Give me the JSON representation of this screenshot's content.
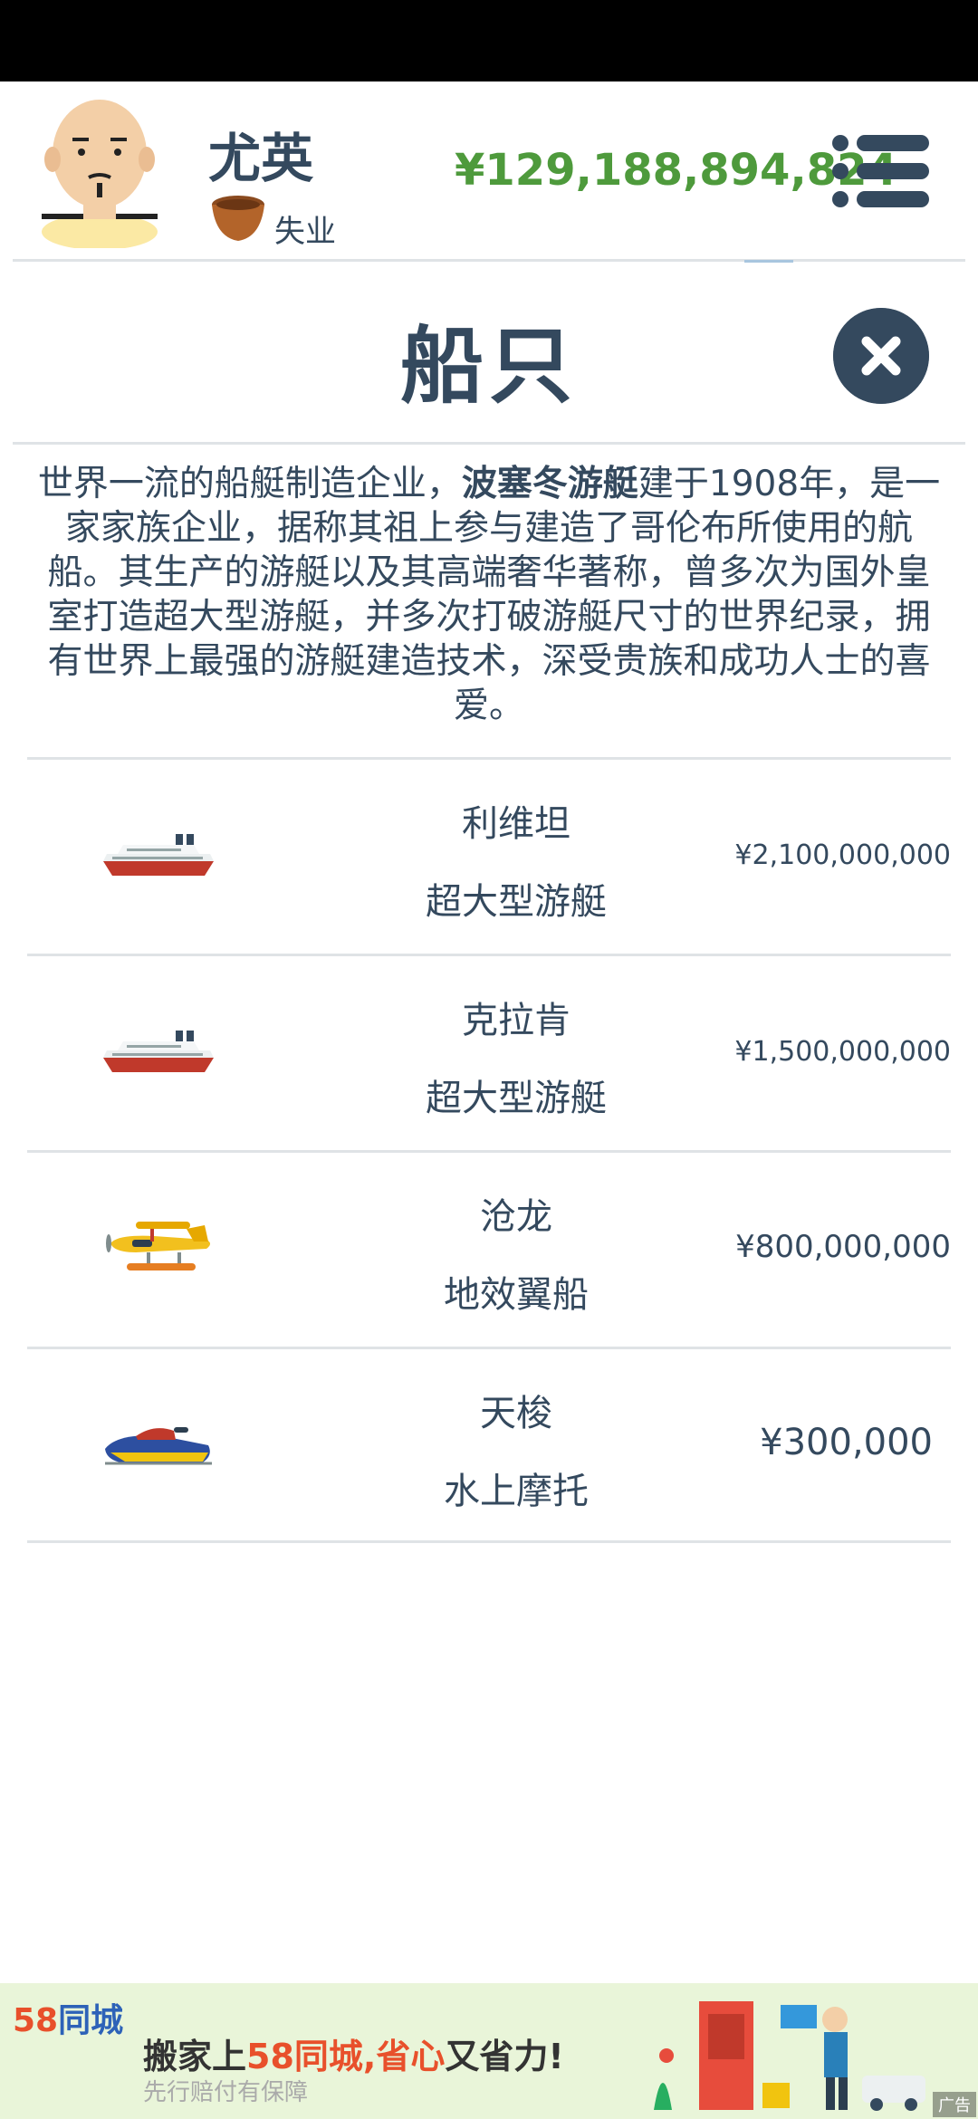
{
  "player": {
    "name": "尤英",
    "job": "失业",
    "money": "¥129,188,894,824"
  },
  "panel": {
    "title": "船只",
    "description_before": "世界一流的船艇制造企业，",
    "description_brand": "波塞冬游艇",
    "description_after": "建于1908年，是一家家族企业，据称其祖上参与建造了哥伦布所使用的航船。其生产的游艇以及其高端奢华著称，曾多次为国外皇室打造超大型游艇，并多次打破游艇尺寸的世界纪录，拥有世界上最强的游艇建造技术，深受贵族和成功人士的喜爱。"
  },
  "items": [
    {
      "name": "利维坦",
      "type": "超大型游艇",
      "price": "¥2,100,000,000",
      "icon": "cruise-ship-icon"
    },
    {
      "name": "克拉肯",
      "type": "超大型游艇",
      "price": "¥1,500,000,000",
      "icon": "cruise-ship-icon"
    },
    {
      "name": "沧龙",
      "type": "地效翼船",
      "price": "¥800,000,000",
      "icon": "seaplane-icon"
    },
    {
      "name": "天梭",
      "type": "水上摩托",
      "price": "¥300,000",
      "icon": "jet-ski-icon"
    }
  ],
  "ad": {
    "logo_num": "58",
    "logo_text": "同城",
    "headline_pre": "搬家上",
    "headline_red": "58同城,省心",
    "headline_post": "又省力!",
    "subline": "先行赔付有保障",
    "tag": "广告"
  },
  "colors": {
    "primary": "#34495e",
    "money": "#4e9a3c",
    "divider": "#dfe3e6",
    "ad_background": "#e9f5d9"
  }
}
